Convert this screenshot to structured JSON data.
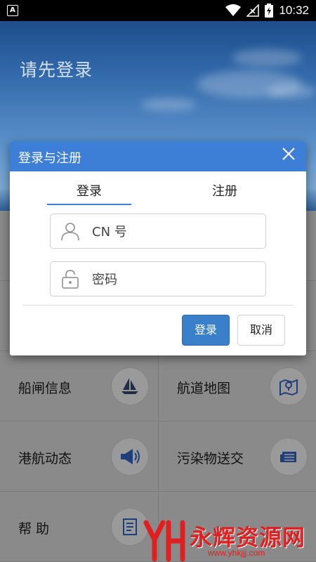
{
  "status_bar": {
    "time": "10:32"
  },
  "header": {
    "title": "请先登录"
  },
  "grid": [
    {
      "label": "船闸信息",
      "icon": "sailboat-icon"
    },
    {
      "label": "航道地图",
      "icon": "map-icon"
    },
    {
      "label": "港航动态",
      "icon": "megaphone-icon"
    },
    {
      "label": "污染物送交",
      "icon": "newspaper-icon"
    },
    {
      "label": "帮 助",
      "icon": "document-icon"
    }
  ],
  "dialog": {
    "title": "登录与注册",
    "tabs": {
      "login": "登录",
      "register": "注册",
      "active": "login"
    },
    "cn_placeholder": "CN 号",
    "password_placeholder": "密码",
    "login_button": "登录",
    "cancel_button": "取消"
  },
  "watermark": {
    "text": "永辉资源网",
    "url": "www.yhkjjj.com"
  },
  "colors": {
    "accent": "#3d7fd6",
    "dim": "#8a8a8a"
  }
}
